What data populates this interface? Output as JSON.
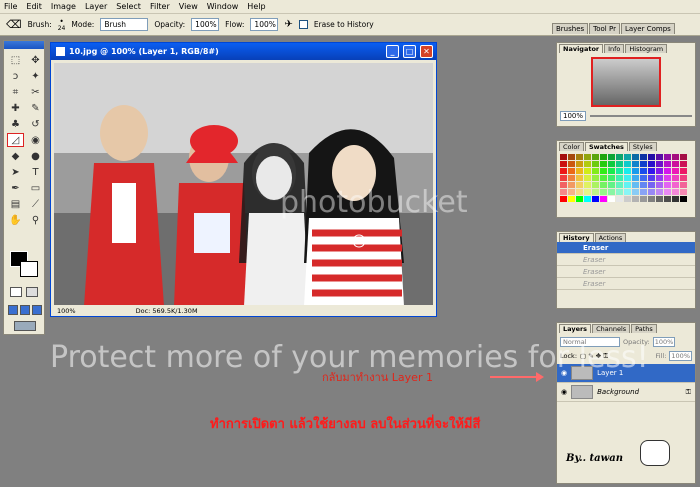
{
  "menu": [
    "File",
    "Edit",
    "Image",
    "Layer",
    "Select",
    "Filter",
    "View",
    "Window",
    "Help"
  ],
  "options": {
    "brush_label": "Brush:",
    "brush_size": "24",
    "mode_label": "Mode:",
    "mode_value": "Brush",
    "opacity_label": "Opacity:",
    "opacity_value": "100%",
    "flow_label": "Flow:",
    "flow_value": "100%",
    "erase_history": "Erase to History"
  },
  "palette_well": [
    "Brushes",
    "Tool Pr",
    "Layer Comps"
  ],
  "document": {
    "title": "10.jpg @ 100% (Layer 1, RGB/8#)",
    "zoom": "100%",
    "doc_size": "Doc: 569.5K/1.30M"
  },
  "navigator": {
    "tabs": [
      "Navigator",
      "Info",
      "Histogram"
    ],
    "zoom": "100%"
  },
  "color_panel": {
    "tabs": [
      "Color",
      "Swatches",
      "Styles"
    ]
  },
  "history": {
    "tabs": [
      "History",
      "Actions"
    ],
    "items": [
      "Eraser",
      "Eraser",
      "Eraser",
      "Eraser"
    ]
  },
  "layers": {
    "tabs": [
      "Layers",
      "Channels",
      "Paths"
    ],
    "blend_mode": "Normal",
    "opacity_label": "Opacity:",
    "opacity_value": "100%",
    "lock_label": "Lock:",
    "fill_label": "Fill:",
    "fill_value": "100%",
    "rows": [
      "Layer 1",
      "Background"
    ]
  },
  "watermark": "Protect more of your memories for less!",
  "photobucket": "photobucket",
  "annotation_1": "กลับมาทำงาน Layer 1",
  "annotation_2": "ทำการเปิดตา แล้วใช้ยางลบ ลบในส่วนที่จะให้มีสี",
  "signature": "By.. tawan",
  "swatch_colors": [
    "#ff0000",
    "#ffff00",
    "#00ff00",
    "#00ffff",
    "#0000ff",
    "#ff00ff",
    "#ffffff",
    "#e6e6e6",
    "#cccccc",
    "#b3b3b3",
    "#999999",
    "#808080",
    "#666666",
    "#4d4d4d",
    "#333333",
    "#000000"
  ]
}
